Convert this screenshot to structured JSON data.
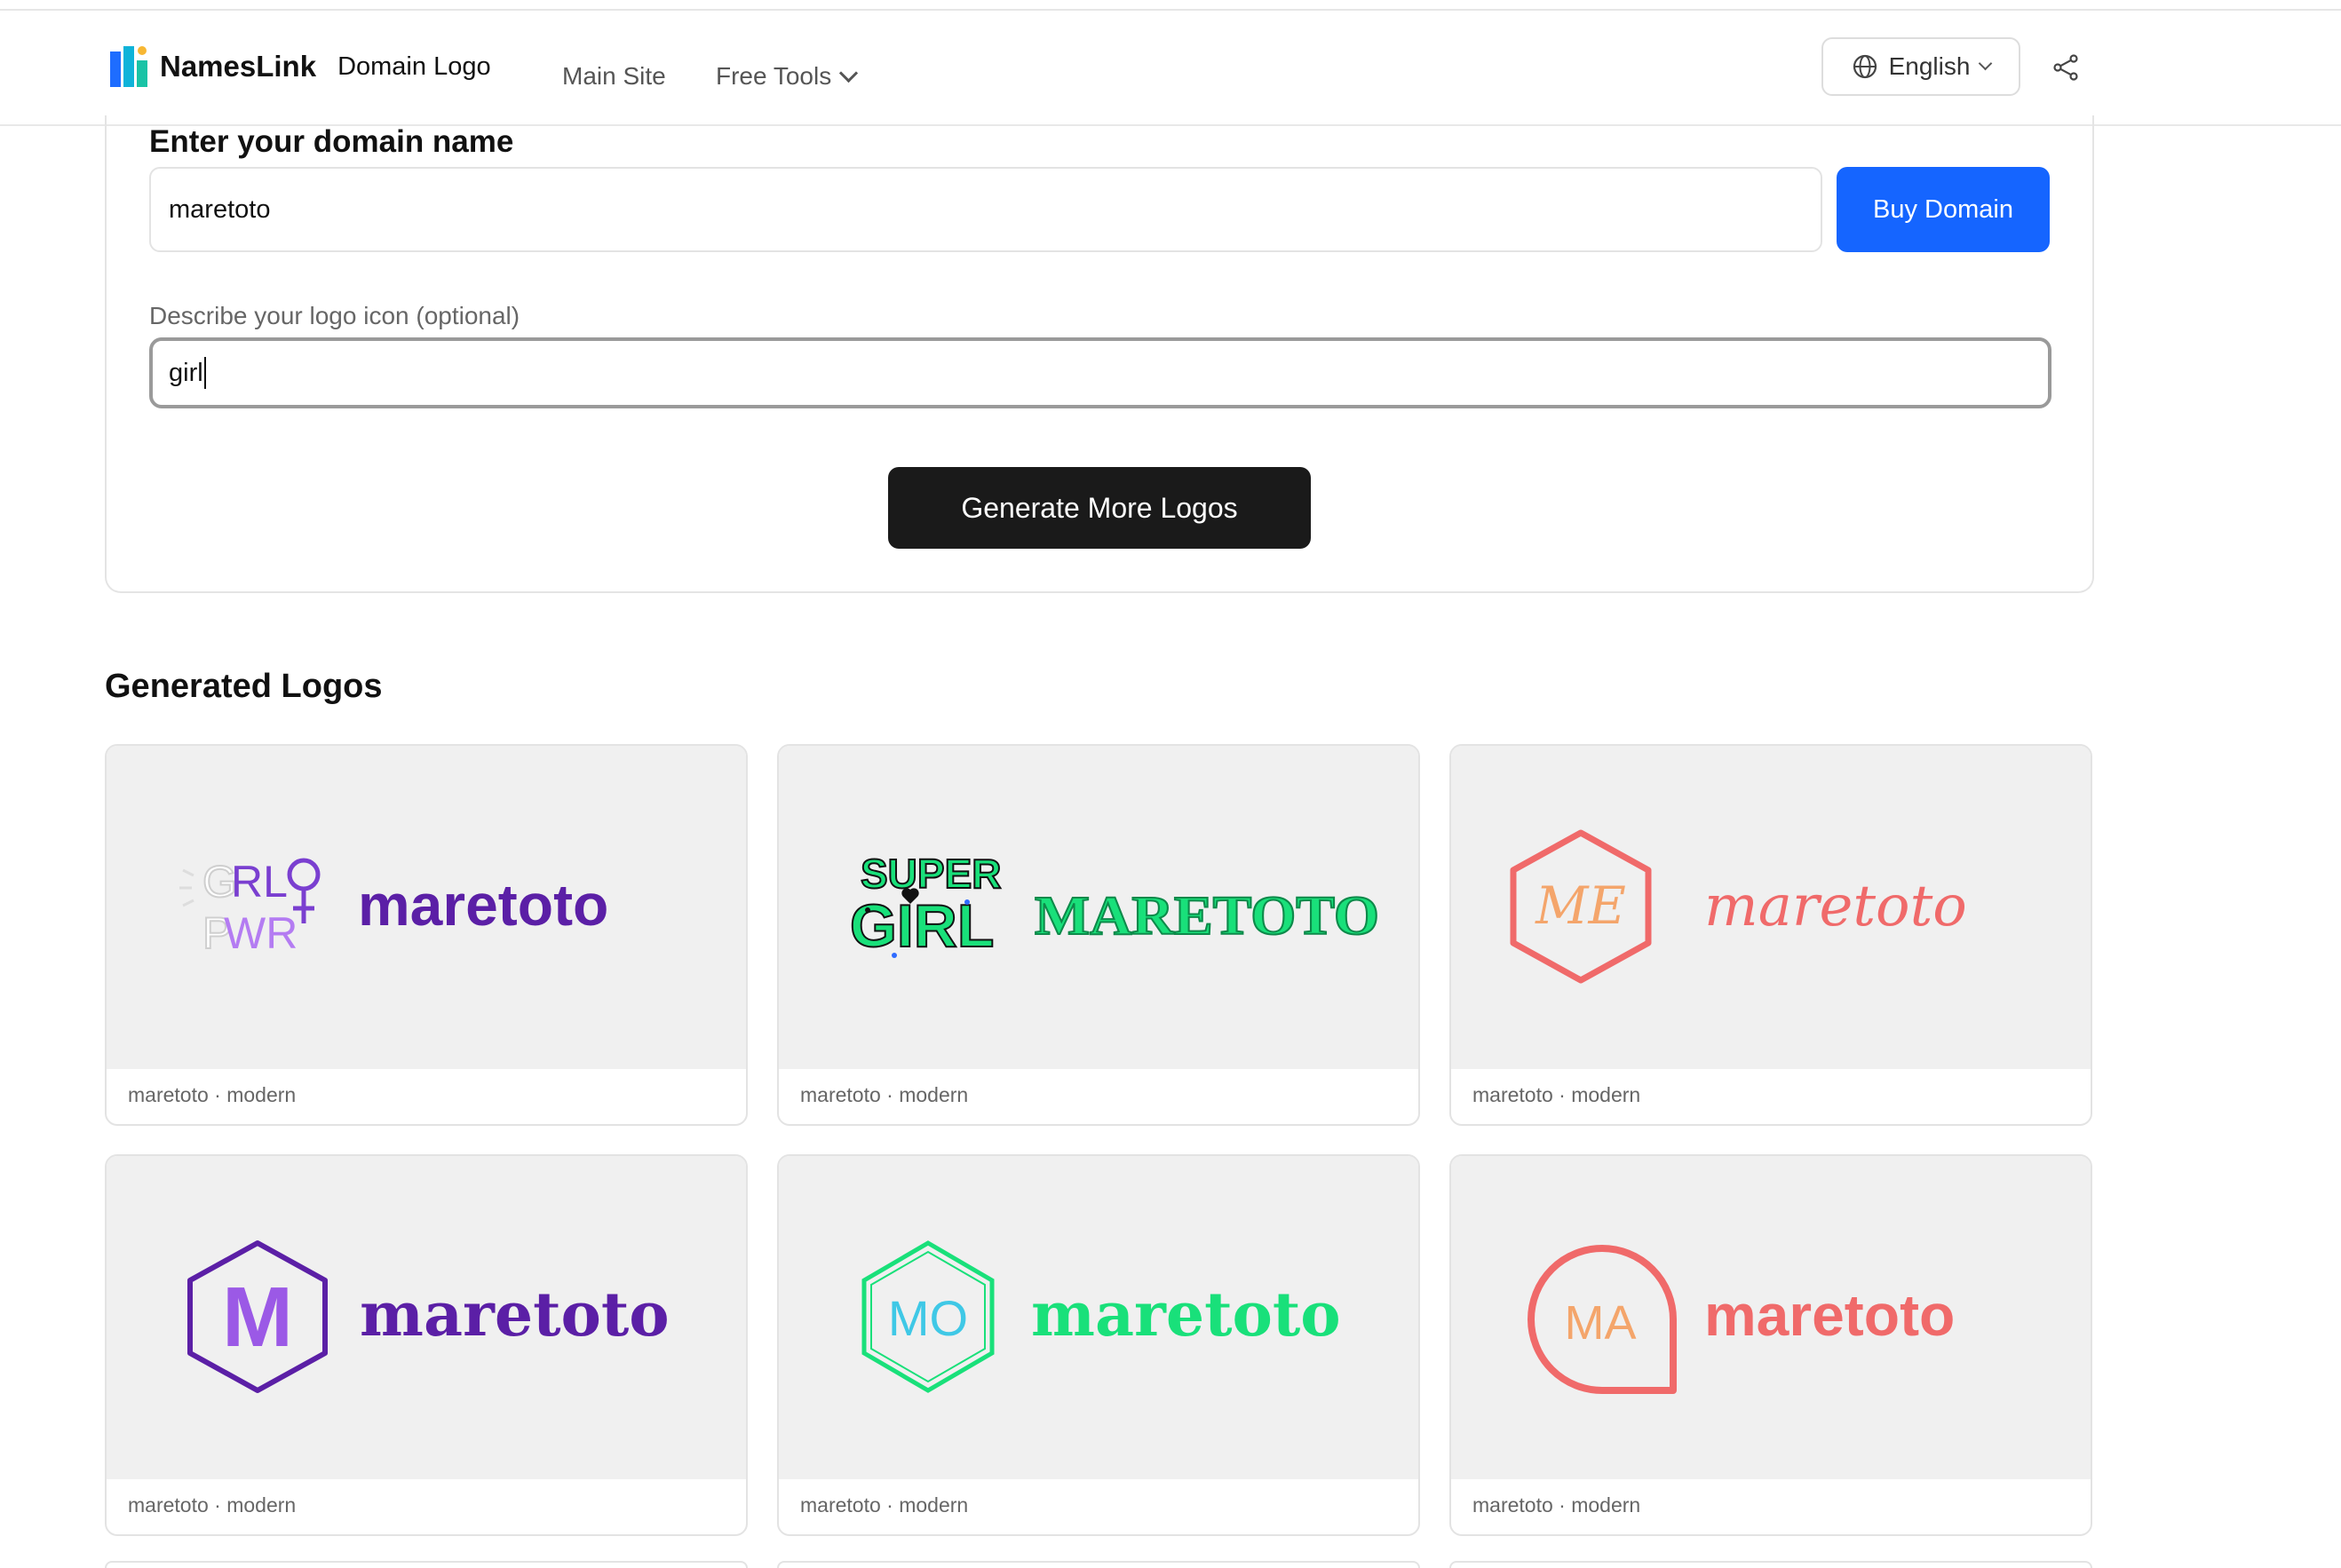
{
  "header": {
    "brand_name": "NamesLink",
    "product_name": "Domain Logo",
    "nav": [
      {
        "label": "Main Site"
      },
      {
        "label": "Free Tools"
      }
    ],
    "language": "English"
  },
  "form": {
    "domain_label": "Enter your domain name",
    "domain_value": "maretoto",
    "buy_button": "Buy Domain",
    "icon_label": "Describe your logo icon (optional)",
    "icon_value": "girl",
    "generate_button": "Generate More Logos"
  },
  "results": {
    "title": "Generated Logos",
    "tiles": [
      {
        "meta": "maretoto · modern",
        "wordmark": "maretoto",
        "badge": "GRL PWR",
        "color": "#5b1fa6"
      },
      {
        "meta": "maretoto · modern",
        "wordmark": "MARETOTO",
        "badge": "SUPER GIRL",
        "color": "#19e07a"
      },
      {
        "meta": "maretoto · modern",
        "wordmark": "maretoto",
        "badge": "ME",
        "color": "#f06a6a"
      },
      {
        "meta": "maretoto · modern",
        "wordmark": "maretoto",
        "badge": "M",
        "color": "#5b1fa6"
      },
      {
        "meta": "maretoto · modern",
        "wordmark": "maretoto",
        "badge": "MO",
        "color": "#19e07a"
      },
      {
        "meta": "maretoto · modern",
        "wordmark": "maretoto",
        "badge": "MA",
        "color": "#f06a6a"
      }
    ]
  }
}
